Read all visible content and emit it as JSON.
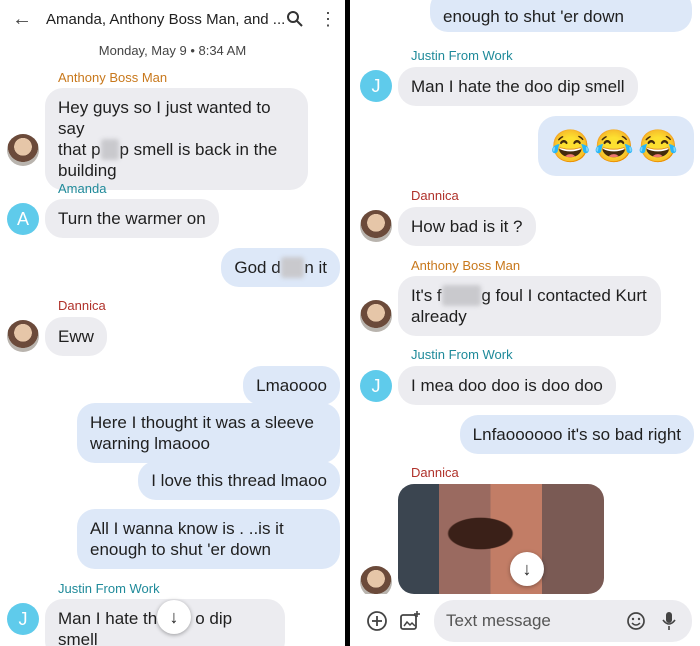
{
  "header": {
    "title": "Amanda, Anthony Boss Man, and ...",
    "date": "Monday, May 9 • 8:34 AM"
  },
  "left": {
    "msg1": {
      "sender": "Anthony Boss Man",
      "line1": "Hey guys so I just wanted to say",
      "line2_pre": "that p",
      "line2_redacted": "oo",
      "line2_post": "p smell is back in the",
      "line3": "building"
    },
    "msg2": {
      "sender": "Amanda",
      "avatar": "A",
      "text": "Turn the warmer on"
    },
    "msg3": {
      "pre": "God d",
      "redacted": "am",
      "post": "n it"
    },
    "msg4": {
      "sender": "Dannica",
      "text": "Eww"
    },
    "msg5": {
      "text": "Lmaoooo"
    },
    "msg6": {
      "line1": "Here I thought it was a sleeve",
      "line2": "warning lmaooo"
    },
    "msg7": {
      "text": "I love this thread lmaoo"
    },
    "msg8": {
      "line1": "All I wanna know is . ..is it",
      "line2": "enough to shut 'er down"
    },
    "msg9": {
      "sender": "Justin From Work",
      "avatar": "J",
      "pre": "Man I hate th",
      "post": "o dip smell"
    }
  },
  "right": {
    "msg0": {
      "text": "enough to shut 'er down"
    },
    "msg1": {
      "sender": "Justin From Work",
      "avatar": "J",
      "text": "Man I hate the doo dip smell"
    },
    "msg2": {
      "text": "😂😂😂"
    },
    "msg3": {
      "sender": "Dannica",
      "text": "How bad is it ?"
    },
    "msg4": {
      "sender": "Anthony Boss Man",
      "line1_pre": "It's f",
      "line1_redacted": "uckin",
      "line1_post": "g foul I contacted Kurt",
      "line2": "already"
    },
    "msg5": {
      "sender": "Justin From Work",
      "avatar": "J",
      "text": "I mea doo doo is doo doo"
    },
    "msg6": {
      "text": "Lnfaoooooo it's so bad right"
    },
    "msg7": {
      "sender": "Dannica"
    }
  },
  "compose": {
    "placeholder": "Text message"
  },
  "icons": {
    "back": "arrow-left",
    "search": "search",
    "more": "more-vert",
    "scroll_down": "arrow-down",
    "add": "add-circle",
    "gallery": "gallery",
    "emoji": "emoji",
    "mic": "mic"
  },
  "colors": {
    "outgoing": "#dde8f8",
    "incoming": "#ececf0",
    "avatar": "#5fcbeb"
  }
}
